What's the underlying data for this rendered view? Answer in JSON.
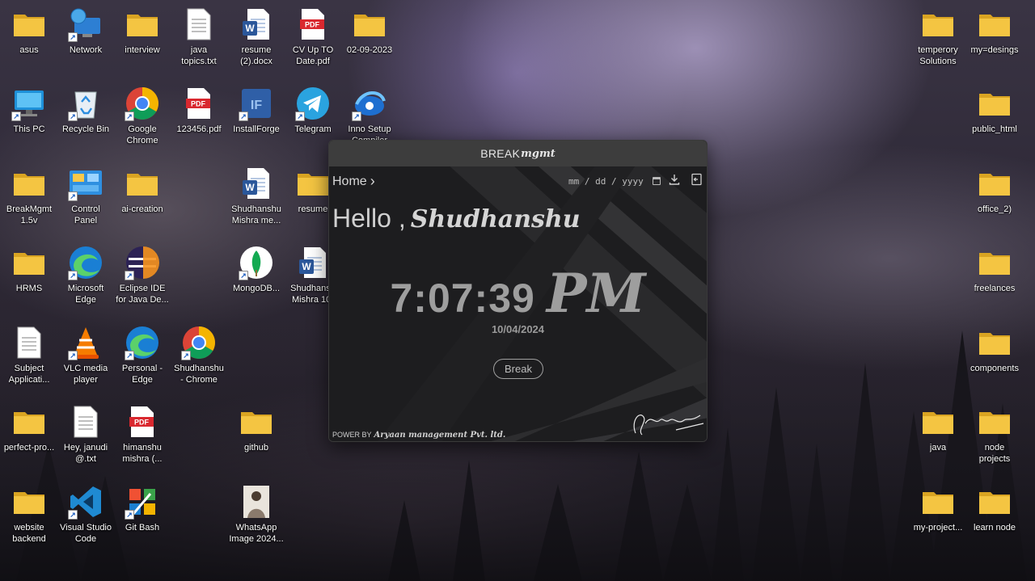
{
  "desktop": {
    "icons": [
      {
        "label": "asus",
        "icon": "folder-icon"
      },
      {
        "label": "Network",
        "icon": "network-icon"
      },
      {
        "label": "interview",
        "icon": "folder-icon"
      },
      {
        "label": "java\ntopics.txt",
        "icon": "text-file-icon"
      },
      {
        "label": "resume\n(2).docx",
        "icon": "word-icon"
      },
      {
        "label": "CV Up TO\nDate.pdf",
        "icon": "pdf-icon"
      },
      {
        "label": "02-09-2023",
        "icon": "folder-icon"
      },
      {
        "label": "temperory\nSolutions",
        "icon": "folder-icon"
      },
      {
        "label": "my=desings",
        "icon": "folder-icon"
      },
      {
        "label": "This PC",
        "icon": "computer-icon"
      },
      {
        "label": "Recycle Bin",
        "icon": "recycle-bin-icon"
      },
      {
        "label": "Google\nChrome",
        "icon": "chrome-icon"
      },
      {
        "label": "123456.pdf",
        "icon": "pdf-icon"
      },
      {
        "label": "InstallForge",
        "icon": "installforge-icon"
      },
      {
        "label": "Telegram",
        "icon": "telegram-icon"
      },
      {
        "label": "Inno Setup\nCompiler",
        "icon": "inno-setup-icon"
      },
      {
        "label": "public_html",
        "icon": "folder-icon"
      },
      {
        "label": "BreakMgmt\n1.5v",
        "icon": "folder-icon"
      },
      {
        "label": "Control\nPanel",
        "icon": "control-panel-icon"
      },
      {
        "label": "ai-creation",
        "icon": "folder-icon"
      },
      {
        "label": "Shudhanshu\nMishra me...",
        "icon": "word-icon"
      },
      {
        "label": "resume",
        "icon": "folder-icon"
      },
      {
        "label": "office_2)",
        "icon": "folder-icon"
      },
      {
        "label": "HRMS",
        "icon": "folder-icon"
      },
      {
        "label": "Microsoft\nEdge",
        "icon": "edge-icon"
      },
      {
        "label": "Eclipse IDE\nfor Java De...",
        "icon": "eclipse-icon"
      },
      {
        "label": "MongoDB...",
        "icon": "mongodb-icon"
      },
      {
        "label": "Shudhansh\nMishra 10-",
        "icon": "word-icon"
      },
      {
        "label": "freelances",
        "icon": "folder-icon"
      },
      {
        "label": "Subject\nApplicati...",
        "icon": "text-file-icon"
      },
      {
        "label": "VLC media\nplayer",
        "icon": "vlc-icon"
      },
      {
        "label": "Personal -\nEdge",
        "icon": "edge-icon"
      },
      {
        "label": "Shudhanshu\n- Chrome",
        "icon": "chrome-icon"
      },
      {
        "label": "components",
        "icon": "folder-icon"
      },
      {
        "label": "perfect-pro...",
        "icon": "folder-icon"
      },
      {
        "label": "Hey, janudi\n@.txt",
        "icon": "text-file-icon"
      },
      {
        "label": "himanshu\nmishra (...",
        "icon": "pdf-icon"
      },
      {
        "label": "github",
        "icon": "folder-icon"
      },
      {
        "label": "java",
        "icon": "folder-icon"
      },
      {
        "label": "node\nprojects",
        "icon": "folder-icon"
      },
      {
        "label": "website\nbackend",
        "icon": "folder-icon"
      },
      {
        "label": "Visual Studio\nCode",
        "icon": "vscode-icon"
      },
      {
        "label": "Git Bash",
        "icon": "git-bash-icon"
      },
      {
        "label": "WhatsApp\nImage 2024...",
        "icon": "image-file-icon"
      },
      {
        "label": "my-project...",
        "icon": "folder-icon"
      },
      {
        "label": "learn node",
        "icon": "folder-icon"
      }
    ]
  },
  "app": {
    "title_plain": "BREAK",
    "title_script": "mgmt",
    "nav_home": "Home",
    "nav_chevron": "›",
    "date_placeholder": "mm / dd / yyyy",
    "greeting": "Hello ,",
    "user_name": "Shudhanshu",
    "time": "7:07:39",
    "ampm": "PM",
    "date": "10/04/2024",
    "break_label": "Break",
    "footer_prefix": "POWER BY",
    "footer_company": "Aryaan management Pvt. ltd."
  },
  "colors": {
    "folder": "#f4c542",
    "pdf": "#d9282f",
    "word": "#2b579a"
  }
}
